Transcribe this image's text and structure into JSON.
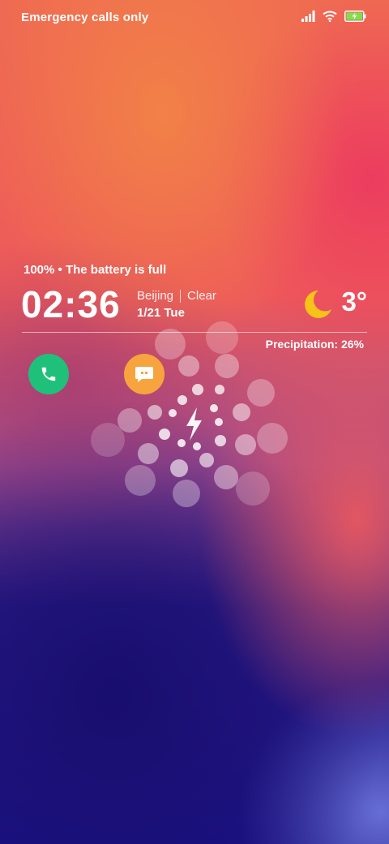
{
  "status_bar": {
    "carrier_text": "Emergency calls only",
    "icons": [
      "signal-icon",
      "wifi-icon",
      "battery-charging-icon"
    ],
    "battery_color": "#7ee04d"
  },
  "lockscreen": {
    "battery_status": "100% • The battery is full",
    "time": "02:36",
    "city": "Beijing",
    "weather_condition": "Clear",
    "date": "1/21 Tue",
    "weather_icon": "crescent-moon-icon",
    "temperature": "3°",
    "precipitation": "Precipitation: 26%"
  },
  "shortcuts": [
    {
      "name": "phone",
      "icon": "phone-icon",
      "color": "#1fc17a"
    },
    {
      "name": "messages",
      "icon": "message-icon",
      "color": "#f7a43e"
    }
  ],
  "charging_animation": {
    "icon": "lightning-bolt-icon",
    "battery_level_percent": 100
  }
}
